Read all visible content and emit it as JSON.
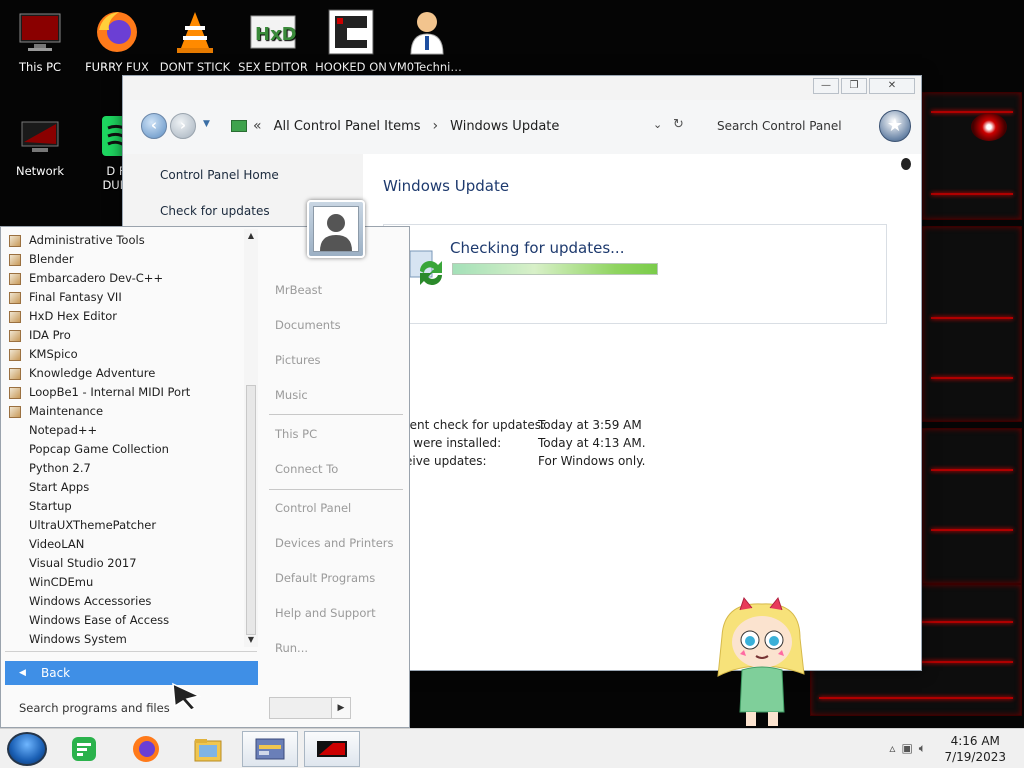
{
  "desktop": {
    "icons": [
      {
        "label": "This PC"
      },
      {
        "label": "FURRY FUX"
      },
      {
        "label": "DONT STICK"
      },
      {
        "label": "SEX EDITOR"
      },
      {
        "label": "HOOKED ON"
      },
      {
        "label": "VM0Technic..."
      },
      {
        "label": "Network"
      },
      {
        "label": "D FC DUMB"
      }
    ]
  },
  "window": {
    "address": {
      "root": "All Control Panel Items",
      "current": "Windows Update"
    },
    "search_placeholder": "Search Control Panel",
    "left_links": {
      "home": "Control Panel Home",
      "check": "Check for updates"
    },
    "title": "Windows Update",
    "status": {
      "title": "Checking for updates...",
      "progress": 1.0
    },
    "info": [
      {
        "key": "recent check for updates:",
        "value": "Today at 3:59 AM"
      },
      {
        "key": "tes were installed:",
        "value": "Today at 4:13 AM."
      },
      {
        "key": "eceive updates:",
        "value": "For Windows only."
      }
    ]
  },
  "startmenu": {
    "programs": [
      {
        "label": "Administrative Tools",
        "icon": true
      },
      {
        "label": "Blender",
        "icon": true
      },
      {
        "label": "Embarcadero Dev-C++",
        "icon": true
      },
      {
        "label": "Final Fantasy VII",
        "icon": true
      },
      {
        "label": "HxD Hex Editor",
        "icon": true
      },
      {
        "label": "IDA Pro",
        "icon": true
      },
      {
        "label": "KMSpico",
        "icon": true
      },
      {
        "label": "Knowledge Adventure",
        "icon": true
      },
      {
        "label": "LoopBe1 - Internal MIDI Port",
        "icon": true
      },
      {
        "label": "Maintenance",
        "icon": true
      },
      {
        "label": "Notepad++",
        "icon": false
      },
      {
        "label": "Popcap Game Collection",
        "icon": false
      },
      {
        "label": "Python 2.7",
        "icon": false
      },
      {
        "label": "Start Apps",
        "icon": false
      },
      {
        "label": "Startup",
        "icon": false
      },
      {
        "label": "UltraUXThemePatcher",
        "icon": false
      },
      {
        "label": "VideoLAN",
        "icon": false
      },
      {
        "label": "Visual Studio 2017",
        "icon": false
      },
      {
        "label": "WinCDEmu",
        "icon": false
      },
      {
        "label": "Windows Accessories",
        "icon": false
      },
      {
        "label": "Windows Ease of Access",
        "icon": false
      },
      {
        "label": "Windows System",
        "icon": false
      }
    ],
    "back": "Back",
    "search": "Search programs and files",
    "right": {
      "user": "MrBeast",
      "documents": "Documents",
      "pictures": "Pictures",
      "music": "Music",
      "this_pc": "This PC",
      "connect": "Connect To",
      "control_panel": "Control Panel",
      "devices": "Devices and Printers",
      "defaults": "Default Programs",
      "help": "Help and Support",
      "run": "Run..."
    }
  },
  "taskbar": {
    "time": "4:16 AM",
    "date": "7/19/2023"
  },
  "colors": {
    "accent": "#3f8fe6",
    "link": "#1e3a6e",
    "gadget_red": "#e01010"
  }
}
